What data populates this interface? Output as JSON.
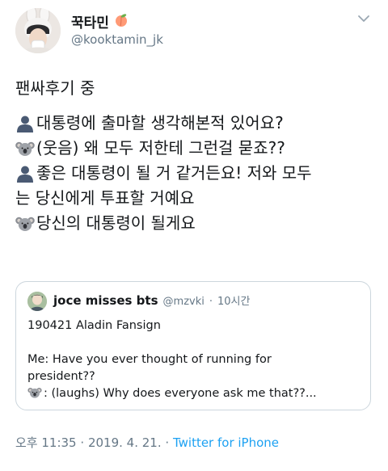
{
  "author": {
    "display_name": "꾹타민",
    "handle": "@kooktamin_jk"
  },
  "tweet": {
    "title": "팬싸후기 중",
    "lines": [
      {
        "icon": "person-silhouette-icon",
        "text": "대통령에 출마할 생각해본적 있어요?"
      },
      {
        "icon": "koala-icon",
        "text": "(웃음) 왜 모두 저한테 그런걸 묻죠??"
      },
      {
        "icon": "person-silhouette-icon",
        "text": "좋은 대통령이 될 거 같거든요! 저와 모두"
      },
      {
        "icon": "",
        "text": "는 당신에게 투표할 거예요"
      },
      {
        "icon": "koala-icon",
        "text": "당신의 대통령이 될게요"
      }
    ]
  },
  "quote": {
    "display_name": "joce misses bts",
    "handle": "@mzvki",
    "separator": "·",
    "time": "10시간",
    "line1": "190421 Aladin Fansign",
    "line2": "Me: Have you ever thought of running for",
    "line3": "president??",
    "line4": ": (laughs) Why does everyone ask me that??..."
  },
  "meta": {
    "time": "오후 11:35",
    "sep1": "·",
    "date": "2019. 4. 21.",
    "sep2": "·",
    "source": "Twitter for iPhone"
  },
  "colors": {
    "text": "#14171a",
    "muted": "#657786",
    "link": "#1da1f2",
    "border": "#ccd6dd"
  }
}
